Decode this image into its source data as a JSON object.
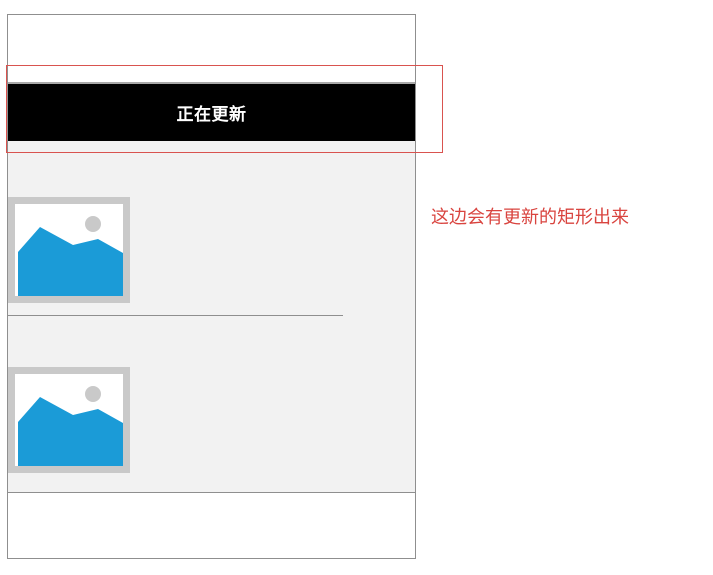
{
  "update_bar": {
    "label": "正在更新"
  },
  "annotation": {
    "text": "这边会有更新的矩形出来",
    "color": "#d9443f"
  },
  "feed": {
    "items": [
      {
        "thumbnail_icon": "image-placeholder-icon"
      },
      {
        "thumbnail_icon": "image-placeholder-icon"
      }
    ]
  },
  "colors": {
    "update_bar_bg": "#000000",
    "update_bar_text": "#ffffff",
    "content_bg": "#f2f2f2",
    "placeholder_frame": "#c9c9c9",
    "placeholder_mountain": "#1b9bd7",
    "placeholder_sun": "#c9c9c9",
    "annotation_border": "#d9534f"
  }
}
